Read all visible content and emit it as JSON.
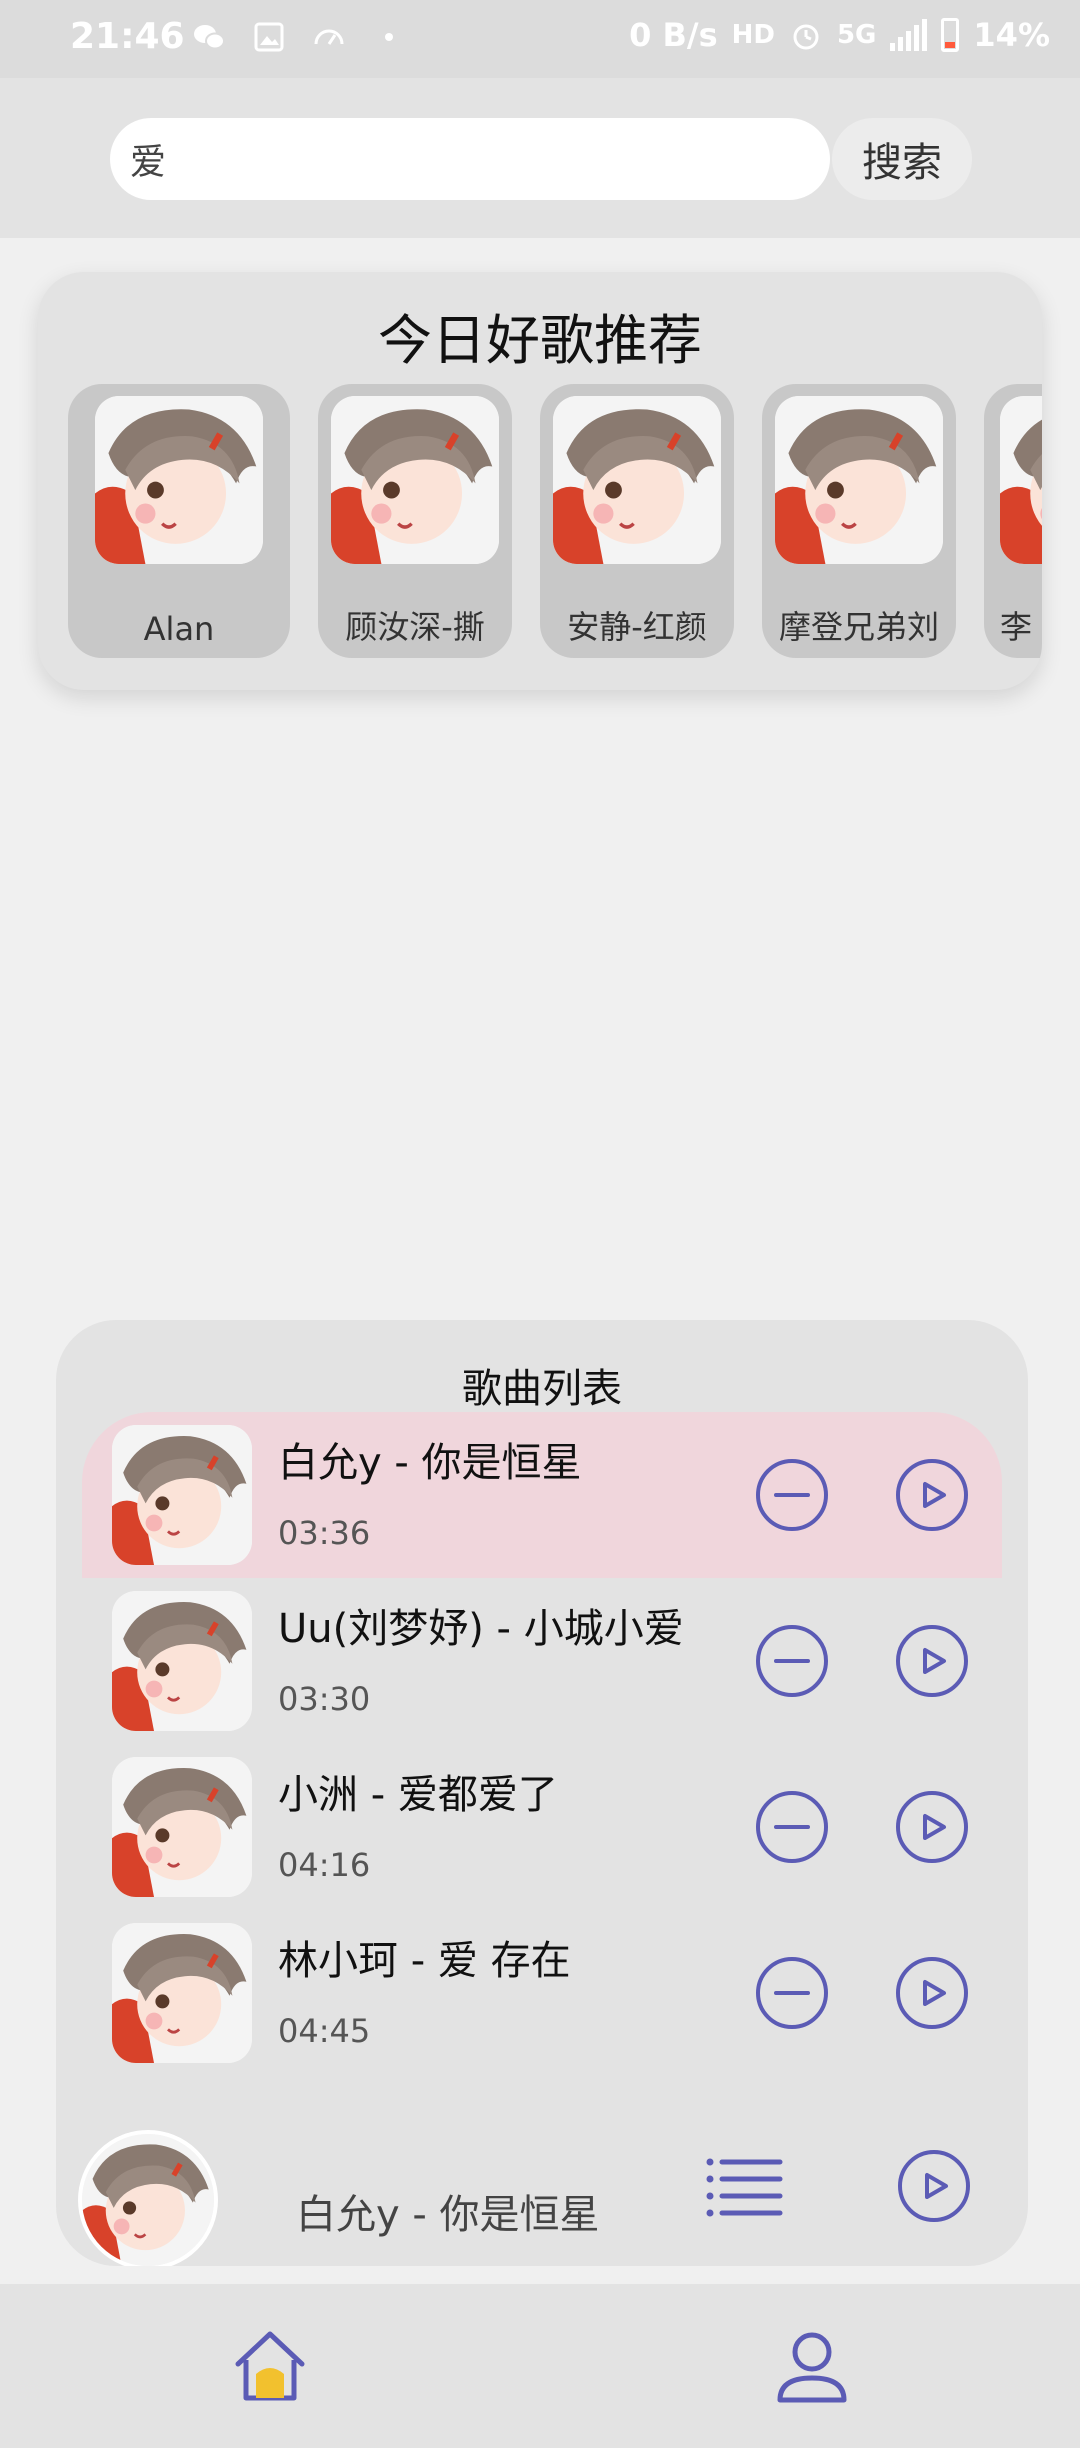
{
  "status_bar": {
    "time": "21:46",
    "net_speed": "0 B/s",
    "hd_badge": "HD",
    "network_type": "5G",
    "battery": "14%"
  },
  "search": {
    "value": "爱",
    "button_label": "搜索"
  },
  "recommend": {
    "title": "今日好歌推荐",
    "items": [
      {
        "label": "Alan"
      },
      {
        "label": "顾汝深-撕"
      },
      {
        "label": "安静-红颜"
      },
      {
        "label": "摩登兄弟刘"
      },
      {
        "label": "李"
      }
    ]
  },
  "song_list": {
    "title": "歌曲列表",
    "songs": [
      {
        "title": "白允y - 你是恒星",
        "duration": "03:36",
        "active": true
      },
      {
        "title": "Uu(刘梦妤) - 小城小爱",
        "duration": "03:30",
        "active": false
      },
      {
        "title": "小洲 - 爱都爱了",
        "duration": "04:16",
        "active": false
      },
      {
        "title": "林小珂 - 爱 存在",
        "duration": "04:45",
        "active": false
      }
    ]
  },
  "player": {
    "now_playing": "白允y - 你是恒星"
  },
  "colors": {
    "accent": "#5b5bb5",
    "active_row": "#f0d6dc",
    "home_fill": "#f2c12e"
  }
}
